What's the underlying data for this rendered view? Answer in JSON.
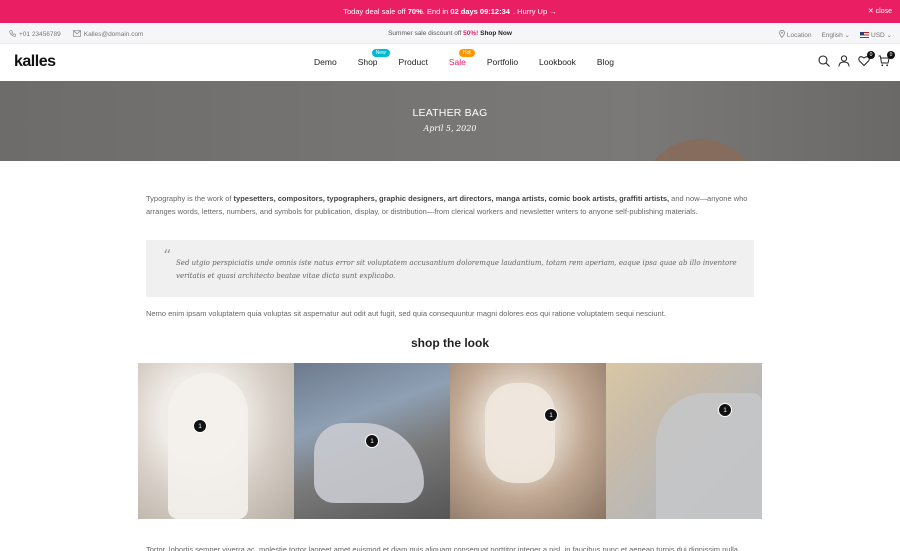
{
  "promo": {
    "prefix": "Today deal sale off",
    "percent": "70%",
    "middle": ". End in",
    "countdown": "02 days 09:12:34",
    "hurry": ". Hurry Up →",
    "close": "✕ close"
  },
  "topbar": {
    "phone": "+01 23456789",
    "email": "Kalles@domain.com",
    "summer_prefix": "Summer sale discount off",
    "summer_percent": "50%!",
    "summer_link": "Shop Now",
    "location": "Location",
    "language": "English ⌄",
    "currency": "USD ⌄"
  },
  "header": {
    "logo": "kalles",
    "nav": [
      {
        "label": "Demo"
      },
      {
        "label": "Shop",
        "badge": "New"
      },
      {
        "label": "Product"
      },
      {
        "label": "Sale",
        "badge": "Hot"
      },
      {
        "label": "Portfolio"
      },
      {
        "label": "Lookbook"
      },
      {
        "label": "Blog"
      }
    ],
    "wishlist_count": "0",
    "cart_count": "0"
  },
  "hero": {
    "title": "LEATHER BAG",
    "date": "April 5, 2020"
  },
  "article": {
    "p1_start": "Typography is the work of ",
    "p1_bold": "typesetters, compositors, typographers, graphic designers, art directors, manga artists, comic book artists, graffiti artists,",
    "p1_end": " and now—anyone who arranges words, letters, numbers, and symbols for publication, display, or distribution—from clerical workers and newsletter writers to anyone self-publishing materials.",
    "quote": "Sed utgio perspiciatis unde omnis iste natus error sit voluptatem accusantium doloremque laudantium, totam rem aperiam, eaque ipsa quae ab illo inventore veritatis et quasi architecto beatae vitae dicta sunt explicabo.",
    "p2": "Nemo enim ipsam voluptatem quia voluptas sit aspernatur aut odit aut fugit, sed quia consequuntur magni dolores eos qui ratione voluptatem sequi nesciunt.",
    "shop_title": "shop the look",
    "hotspot_label": "1",
    "p3": "Tortor, lobortis semper viverra ac, molestie tortor laoreet amet euismod et diam quis aliquam consequat porttitor integer a nisl, in faucibus nunc et aenean turpis dui dignissim nulla."
  },
  "colors": {
    "accent": "#e91e63",
    "new_badge": "#01bad4",
    "hot_badge": "#ff9800"
  }
}
